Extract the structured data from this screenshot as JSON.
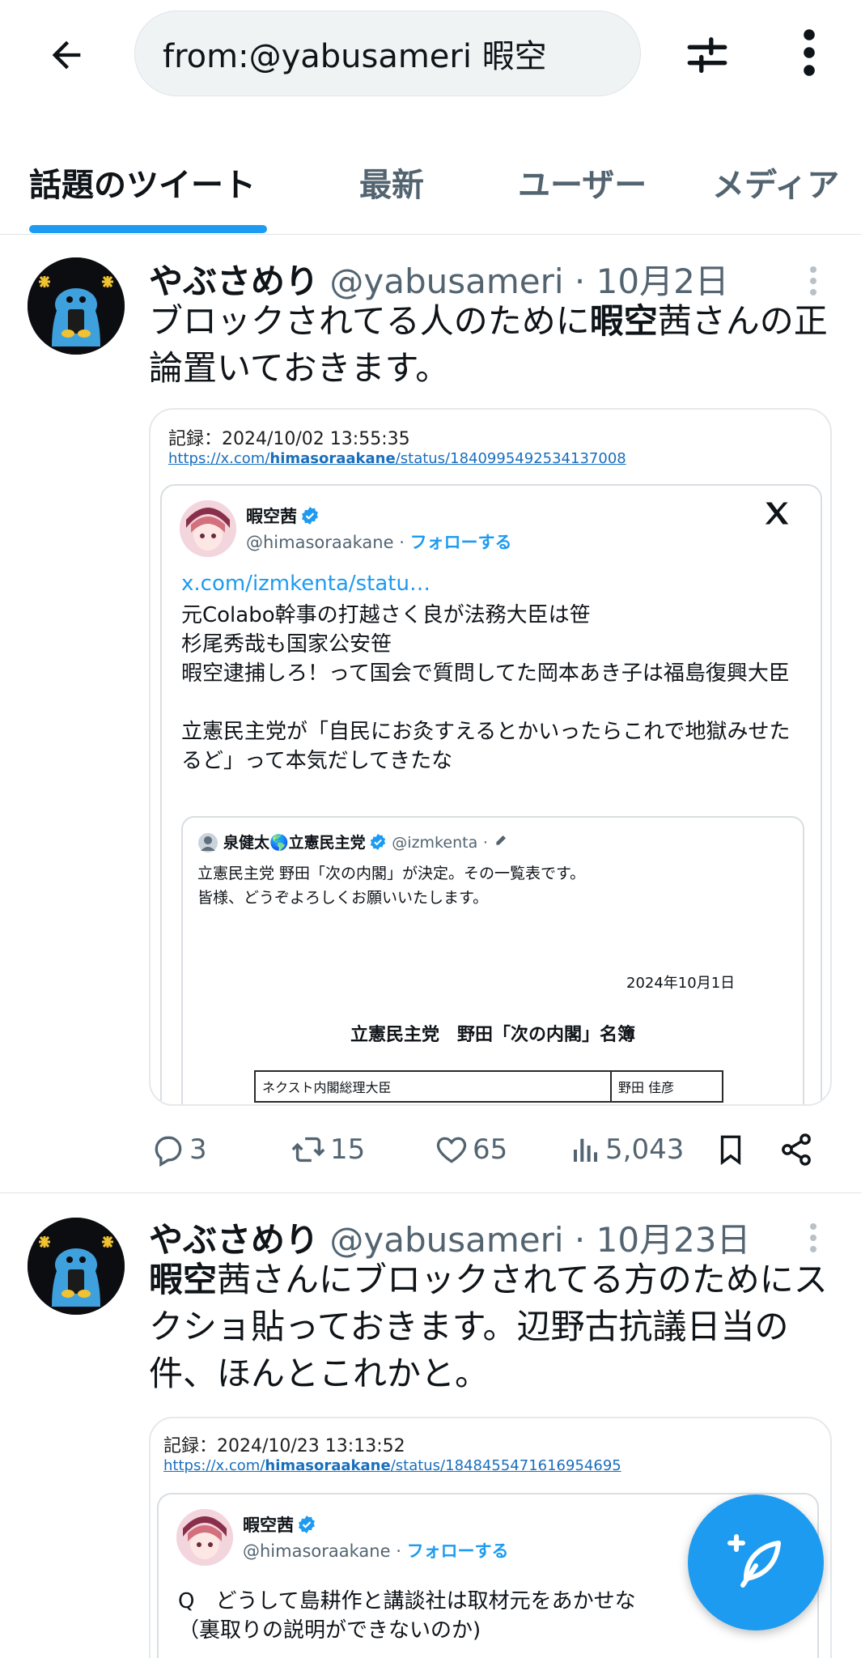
{
  "search": {
    "query": "from:@yabusameri 暇空"
  },
  "tabs": [
    "話題のツイート",
    "最新",
    "ユーザー",
    "メディア"
  ],
  "tweets": [
    {
      "author": "やぶさめり",
      "handle": "@yabusameri",
      "time": "10月2日",
      "text_bold": "暇空",
      "text_pre": "ブロックされてる人のために",
      "text_post": "茜さんの正論置いておきます。",
      "record_line": "記録：2024/10/02 13:55:35",
      "url_pre": "https://x.com/",
      "url_bold": "himasoraakane",
      "url_post": "/status/1840995492534137008",
      "embed": {
        "name": "暇空茜",
        "handle": "@himasoraakane",
        "follow": "フォローする",
        "link": "x.com/izmkenta/statu…",
        "body": "元Colabo幹事の打越さく良が法務大臣は笹\n杉尾秀哉も国家公安笹\n暇空逮捕しろ！って国会で質問してた岡本あき子は福島復興大臣\n\n立憲民主党が「自民にお灸すえるとかいったらこれで地獄みせたるど」って本気だしてきたな",
        "quote": {
          "name": "泉健太🌎立憲民主党",
          "handle": "@izmkenta",
          "text": "立憲民主党 野田「次の内閣」が決定。その一覧表です。\n皆様、どうぞよろしくお願いいたします。",
          "date": "2024年10月1日",
          "title": "立憲民主党　野田「次の内閣」名簿",
          "row_left": "ネクスト内閣総理大臣",
          "row_right": "野田 佳彦"
        }
      },
      "replies": "3",
      "retweets": "15",
      "likes": "65",
      "views": "5,043"
    },
    {
      "author": "やぶさめり",
      "handle": "@yabusameri",
      "time": "10月23日",
      "text_bold": "暇空",
      "text_post": "茜さんにブロックされてる方のためにスクショ貼っておきます。辺野古抗議日当の件、ほんとこれかと。",
      "record_line": "記録：2024/10/23 13:13:52",
      "url_pre": "https://x.com/",
      "url_bold": "himasoraakane",
      "url_post": "/status/1848455471616954695",
      "embed": {
        "name": "暇空茜",
        "handle": "@himasoraakane",
        "follow": "フォローする",
        "body": "Q　どうして島耕作と講談社は取材元をあかせな\n（裏取りの説明ができないのか)"
      }
    }
  ],
  "colors": {
    "accent": "#1d9bf0",
    "text": "#0f1419",
    "muted": "#536471"
  },
  "icons": [
    "back-arrow-icon",
    "filter-sliders-icon",
    "more-vertical-icon",
    "reply-icon",
    "retweet-icon",
    "like-icon",
    "views-icon",
    "bookmark-icon",
    "share-icon",
    "x-logo-icon",
    "verified-badge-icon",
    "compose-feather-icon"
  ]
}
